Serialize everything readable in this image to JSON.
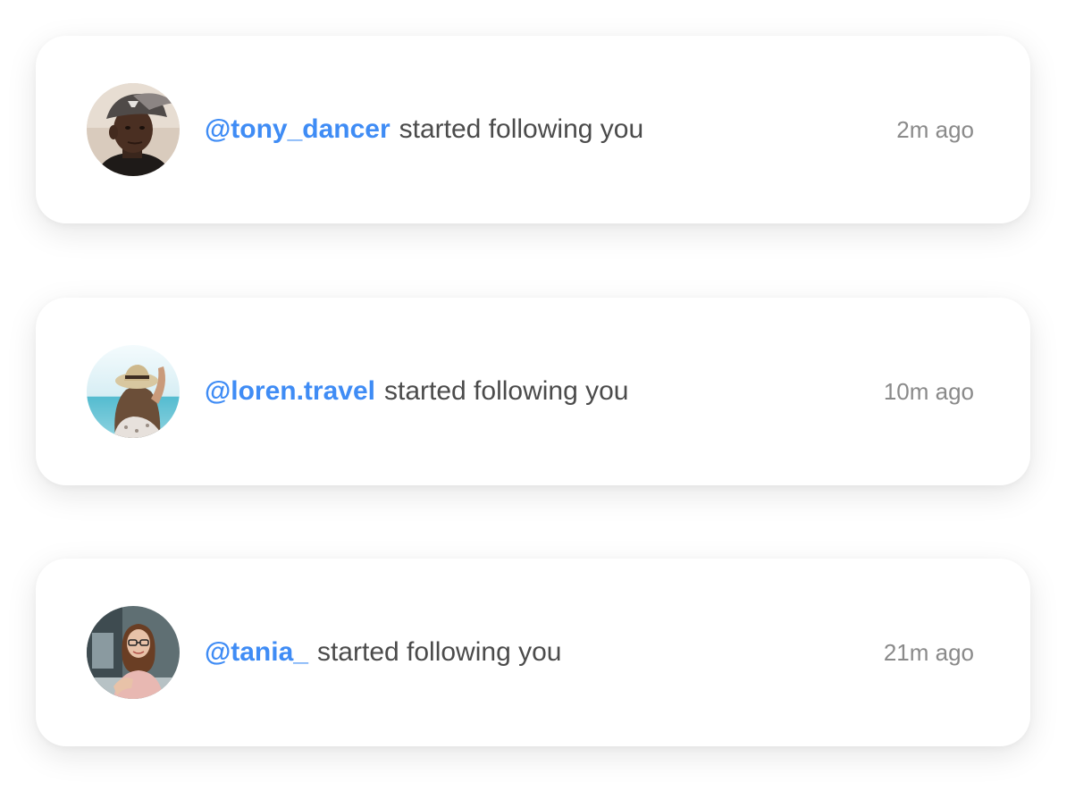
{
  "notifications": [
    {
      "handle": "@tony_dancer",
      "action": "started following you",
      "time": "2m ago",
      "avatar_icon": "user-photo-man-cap-icon"
    },
    {
      "handle": "@loren.travel",
      "action": "started following you",
      "time": "10m ago",
      "avatar_icon": "user-photo-woman-hat-beach-icon"
    },
    {
      "handle": "@tania_",
      "action": "started following you",
      "time": "21m ago",
      "avatar_icon": "user-photo-woman-glasses-icon"
    }
  ],
  "colors": {
    "handle": "#3f8cf5",
    "text": "#4b4b4b",
    "time": "#8a8a8a",
    "card": "#ffffff"
  }
}
